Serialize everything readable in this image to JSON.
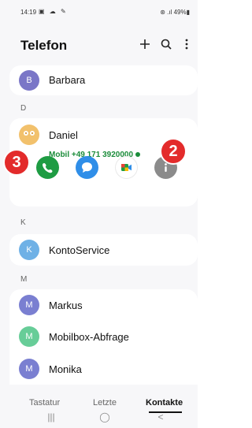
{
  "status_bar": {
    "time": "14:19",
    "left_icons": "▣ ☁ ✎",
    "right": "⊛ .ıl 49%▮"
  },
  "header": {
    "title": "Telefon",
    "icons": [
      "plus-icon",
      "search-icon",
      "more-vert-icon"
    ]
  },
  "contacts": [
    {
      "name": "Barbara",
      "initial": "B",
      "color": "#7a76c7"
    },
    {
      "section": "D"
    },
    {
      "name": "Daniel",
      "initial": "",
      "color": "#f2c16c",
      "expanded": true,
      "detail": "Mobil +49 171 3920000"
    },
    {
      "section": "K"
    },
    {
      "name": "KontoService",
      "initial": "K",
      "color": "#6fb1e6"
    },
    {
      "section": "M"
    },
    {
      "name": "Markus",
      "initial": "M",
      "color": "#7a7fd1"
    },
    {
      "name": "Mobilbox-Abfrage",
      "initial": "M",
      "color": "#67cd98"
    },
    {
      "name": "Monika",
      "initial": "M",
      "color": "#7a7fd1"
    }
  ],
  "actions": [
    {
      "name": "call-button",
      "color": "#1e9c43"
    },
    {
      "name": "message-button",
      "color": "#2f8ee8"
    },
    {
      "name": "video-call-button",
      "color": "#ffffff"
    },
    {
      "name": "info-button",
      "color": "#8b8b8b"
    }
  ],
  "badges": {
    "b2": "2",
    "b3": "3"
  },
  "tabs": {
    "tab1": "Tastatur",
    "tab2": "Letzte",
    "tab3": "Kontakte"
  },
  "nav": {
    "recents": "|||",
    "home": "◯",
    "back": "<"
  }
}
